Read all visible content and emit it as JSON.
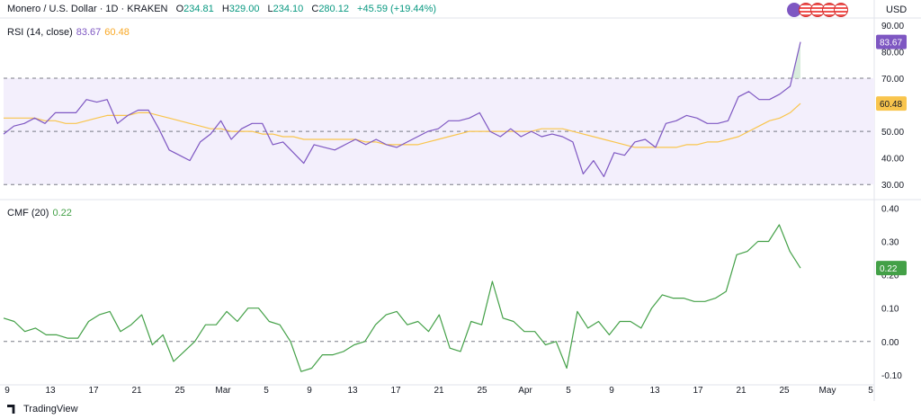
{
  "header": {
    "symbol": "Monero / U.S. Dollar · 1D · KRAKEN",
    "open_label": "O",
    "open": "234.81",
    "high_label": "H",
    "high": "329.00",
    "low_label": "L",
    "low": "234.10",
    "close_label": "C",
    "close": "280.12",
    "change": "+45.59 (+19.44%)"
  },
  "currency": "USD",
  "rsi_panel": {
    "label": "RSI (14, close)",
    "rsi_value": "83.67",
    "ma_value": "60.48"
  },
  "cmf_panel": {
    "label": "CMF (20)",
    "value": "0.22"
  },
  "footer": {
    "brand": "TradingView"
  },
  "colors": {
    "rsi": "#7e57c2",
    "rsi_ma": "#f9c54d",
    "cmf": "#43a047",
    "band_fill": "#f3effc",
    "grid": "#e0e3eb"
  },
  "chart_data": [
    {
      "type": "line",
      "title": "RSI (14, close)",
      "ylim": [
        25,
        92
      ],
      "y_ticks": [
        "90.00",
        "80.00",
        "70.00",
        "60.00",
        "50.00",
        "40.00",
        "30.00"
      ],
      "band": [
        30,
        70
      ],
      "midline": 50,
      "series": [
        {
          "name": "RSI",
          "values": [
            49,
            52,
            53,
            55,
            53,
            57,
            57,
            57,
            62,
            61,
            62,
            53,
            56,
            58,
            58,
            51,
            43,
            41,
            39,
            46,
            49,
            54,
            47,
            51,
            53,
            53,
            45,
            46,
            42,
            38,
            45,
            44,
            43,
            45,
            47,
            45,
            47,
            45,
            44,
            46,
            48,
            50,
            51,
            54,
            54,
            55,
            57,
            50,
            48,
            51,
            48,
            50,
            48,
            49,
            48,
            46,
            34,
            39,
            33,
            42,
            41,
            46,
            47,
            44,
            53,
            54,
            56,
            55,
            53,
            53,
            54,
            63,
            65,
            62,
            62,
            64,
            67,
            83.67
          ]
        },
        {
          "name": "RSI-based MA",
          "values": [
            55,
            55,
            55,
            55,
            54,
            54,
            53,
            53,
            54,
            55,
            56,
            56,
            56,
            57,
            57,
            56,
            55,
            54,
            53,
            52,
            51,
            51,
            50,
            50,
            50,
            49,
            49,
            48,
            48,
            47,
            47,
            47,
            47,
            47,
            47,
            46,
            46,
            45,
            45,
            45,
            45,
            46,
            47,
            48,
            49,
            50,
            50,
            50,
            50,
            50,
            50,
            50,
            51,
            51,
            51,
            50,
            49,
            48,
            47,
            46,
            45,
            44,
            44,
            44,
            44,
            44,
            45,
            45,
            46,
            46,
            47,
            48,
            50,
            52,
            54,
            55,
            57,
            60.48
          ]
        }
      ]
    },
    {
      "type": "line",
      "title": "CMF (20)",
      "ylim": [
        -0.13,
        0.42
      ],
      "y_ticks": [
        "0.40",
        "0.30",
        "0.20",
        "0.10",
        "0.00",
        "-0.10"
      ],
      "zero_line": 0,
      "categories": [
        "9",
        "13",
        "17",
        "21",
        "25",
        "Mar",
        "5",
        "9",
        "13",
        "17",
        "21",
        "25",
        "Apr",
        "5",
        "9",
        "13",
        "17",
        "21",
        "25",
        "May",
        "5"
      ],
      "series": [
        {
          "name": "CMF",
          "values": [
            0.07,
            0.06,
            0.03,
            0.04,
            0.02,
            0.02,
            0.01,
            0.01,
            0.06,
            0.08,
            0.09,
            0.03,
            0.05,
            0.08,
            -0.01,
            0.02,
            -0.06,
            -0.03,
            0.0,
            0.05,
            0.05,
            0.09,
            0.06,
            0.1,
            0.1,
            0.06,
            0.05,
            0.0,
            -0.09,
            -0.08,
            -0.04,
            -0.04,
            -0.03,
            -0.01,
            0.0,
            0.05,
            0.08,
            0.09,
            0.05,
            0.06,
            0.03,
            0.08,
            -0.02,
            -0.03,
            0.06,
            0.05,
            0.18,
            0.07,
            0.06,
            0.03,
            0.03,
            -0.01,
            0.0,
            -0.08,
            0.09,
            0.04,
            0.06,
            0.02,
            0.06,
            0.06,
            0.04,
            0.1,
            0.14,
            0.13,
            0.13,
            0.12,
            0.12,
            0.13,
            0.15,
            0.26,
            0.27,
            0.3,
            0.3,
            0.35,
            0.27,
            0.22
          ]
        }
      ]
    }
  ]
}
